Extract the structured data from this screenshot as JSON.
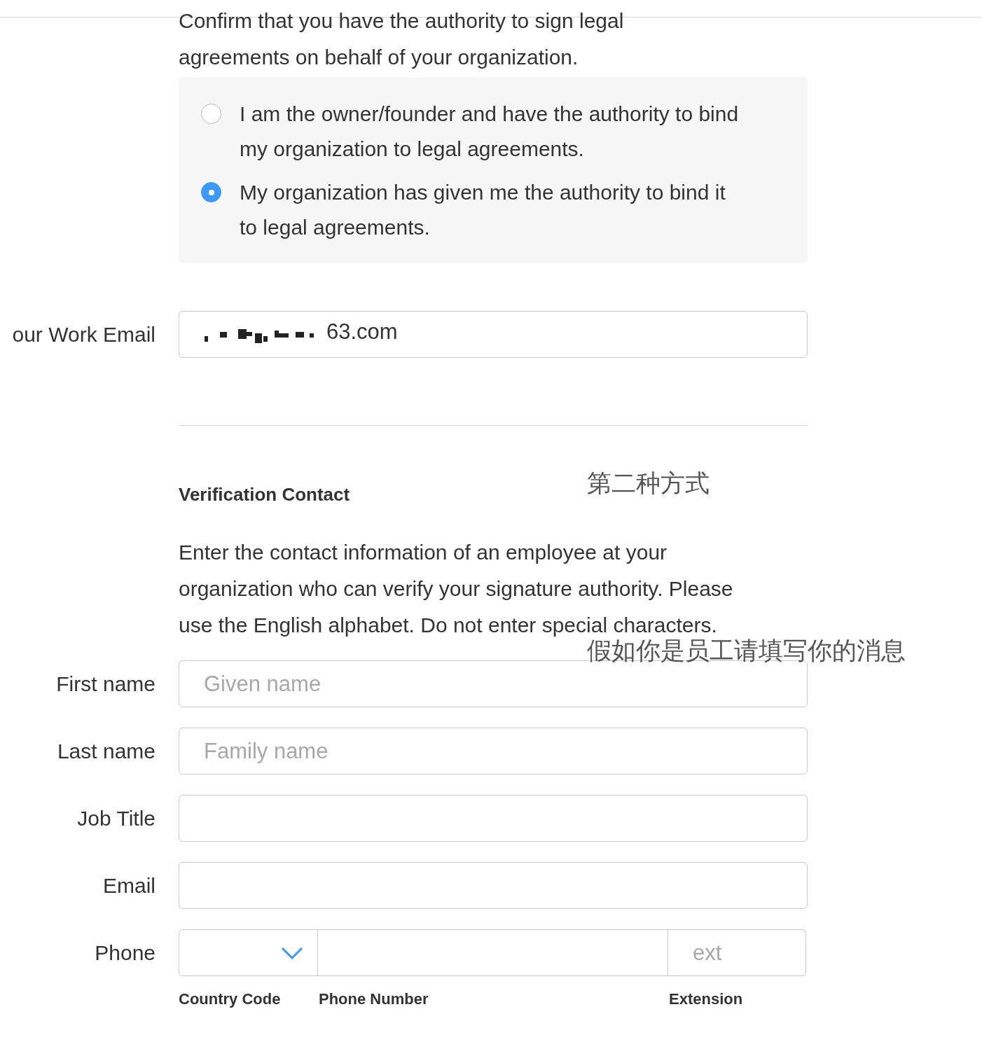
{
  "intro": "Confirm that you have the authority to sign legal agreements on behalf of your organization.",
  "authority_options": [
    {
      "label": "I am the owner/founder and have the authority to bind my organization to legal agreements.",
      "selected": false
    },
    {
      "label": "My organization has given me the authority to bind it to legal agreements.",
      "selected": true
    }
  ],
  "work_email": {
    "label": "our Work Email",
    "value": "63.com"
  },
  "verification": {
    "heading": "Verification Contact",
    "annotation": "第二种方式",
    "description": "Enter the contact information of an employee at your organization who can verify your signature authority. Please use the English alphabet. Do not enter special characters.",
    "description_annotation": "假如你是员工请填写你的消息"
  },
  "fields": [
    {
      "label": "First name",
      "placeholder": "Given name"
    },
    {
      "label": "Last name",
      "placeholder": "Family name"
    },
    {
      "label": "Job Title"
    },
    {
      "label": "Email"
    }
  ],
  "phone": {
    "label": "Phone",
    "ext_placeholder": "ext",
    "captions": [
      "Country Code",
      "Phone Number",
      "Extension"
    ]
  }
}
